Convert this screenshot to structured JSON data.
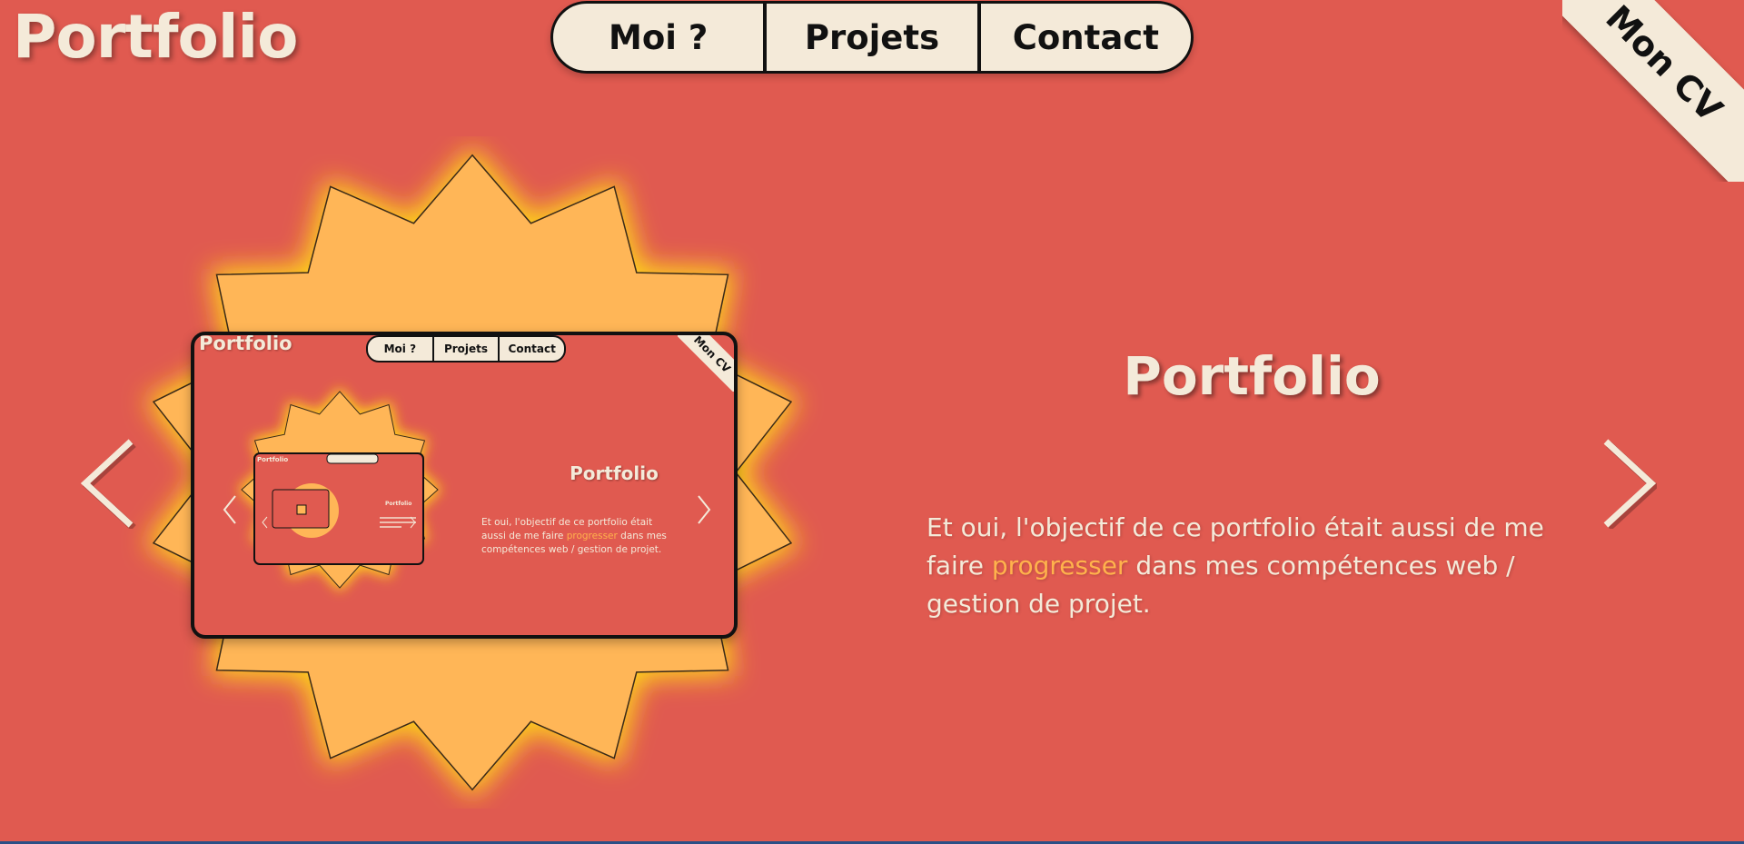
{
  "header": {
    "logo": "Portfolio",
    "nav": [
      "Moi ?",
      "Projets",
      "Contact"
    ],
    "cv_label": "Mon CV"
  },
  "carousel": {
    "prev_icon": "chevron-left-icon",
    "next_icon": "chevron-right-icon"
  },
  "preview": {
    "logo": "Portfolio",
    "nav": [
      "Moi ?",
      "Projets",
      "Contact"
    ],
    "cv_label": "Mon CV",
    "title": "Portfolio",
    "desc_before": "Et oui, l'objectif de ce portfolio était aussi de me faire ",
    "desc_highlight": "progresser",
    "desc_after": " dans mes compétences web / gestion de projet."
  },
  "project": {
    "title": "Portfolio",
    "desc_before": "Et oui, l'objectif de ce portfolio était aussi de me faire ",
    "desc_highlight": "progresser",
    "desc_after": " dans mes compétences web / gestion de projet."
  },
  "colors": {
    "background": "#e05a50",
    "cream": "#f4ead9",
    "accent": "#ffb24c",
    "star": "#ffb657"
  }
}
